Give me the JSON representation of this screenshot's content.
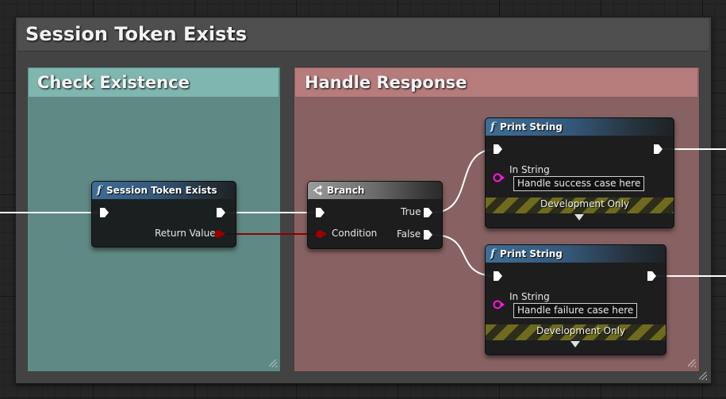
{
  "outer_comment": {
    "title": "Session Token Exists"
  },
  "comments": {
    "check_existence": {
      "title": "Check Existence",
      "color": "#7fb2ab"
    },
    "handle_response": {
      "title": "Handle Response",
      "color": "#b47b7b"
    }
  },
  "nodes": {
    "session_token_exists": {
      "title": "Session Token Exists",
      "icon": "function-icon",
      "outputs": {
        "return_value": "Return Value"
      }
    },
    "branch": {
      "title": "Branch",
      "icon": "branch-icon",
      "inputs": {
        "condition": "Condition"
      },
      "outputs": {
        "true": "True",
        "false": "False"
      }
    },
    "print_success": {
      "title": "Print String",
      "icon": "function-icon",
      "in_string_label": "In String",
      "in_string_value": "Handle success case here",
      "dev_label": "Development Only"
    },
    "print_failure": {
      "title": "Print String",
      "icon": "function-icon",
      "in_string_label": "In String",
      "in_string_value": "Handle failure case here",
      "dev_label": "Development Only"
    }
  },
  "colors": {
    "exec_wire": "#ffffff",
    "bool_wire": "#8c0000",
    "bool_pin": "#9b0000",
    "string_pin": "#ff17d8",
    "function_header": "#3f6d96"
  }
}
